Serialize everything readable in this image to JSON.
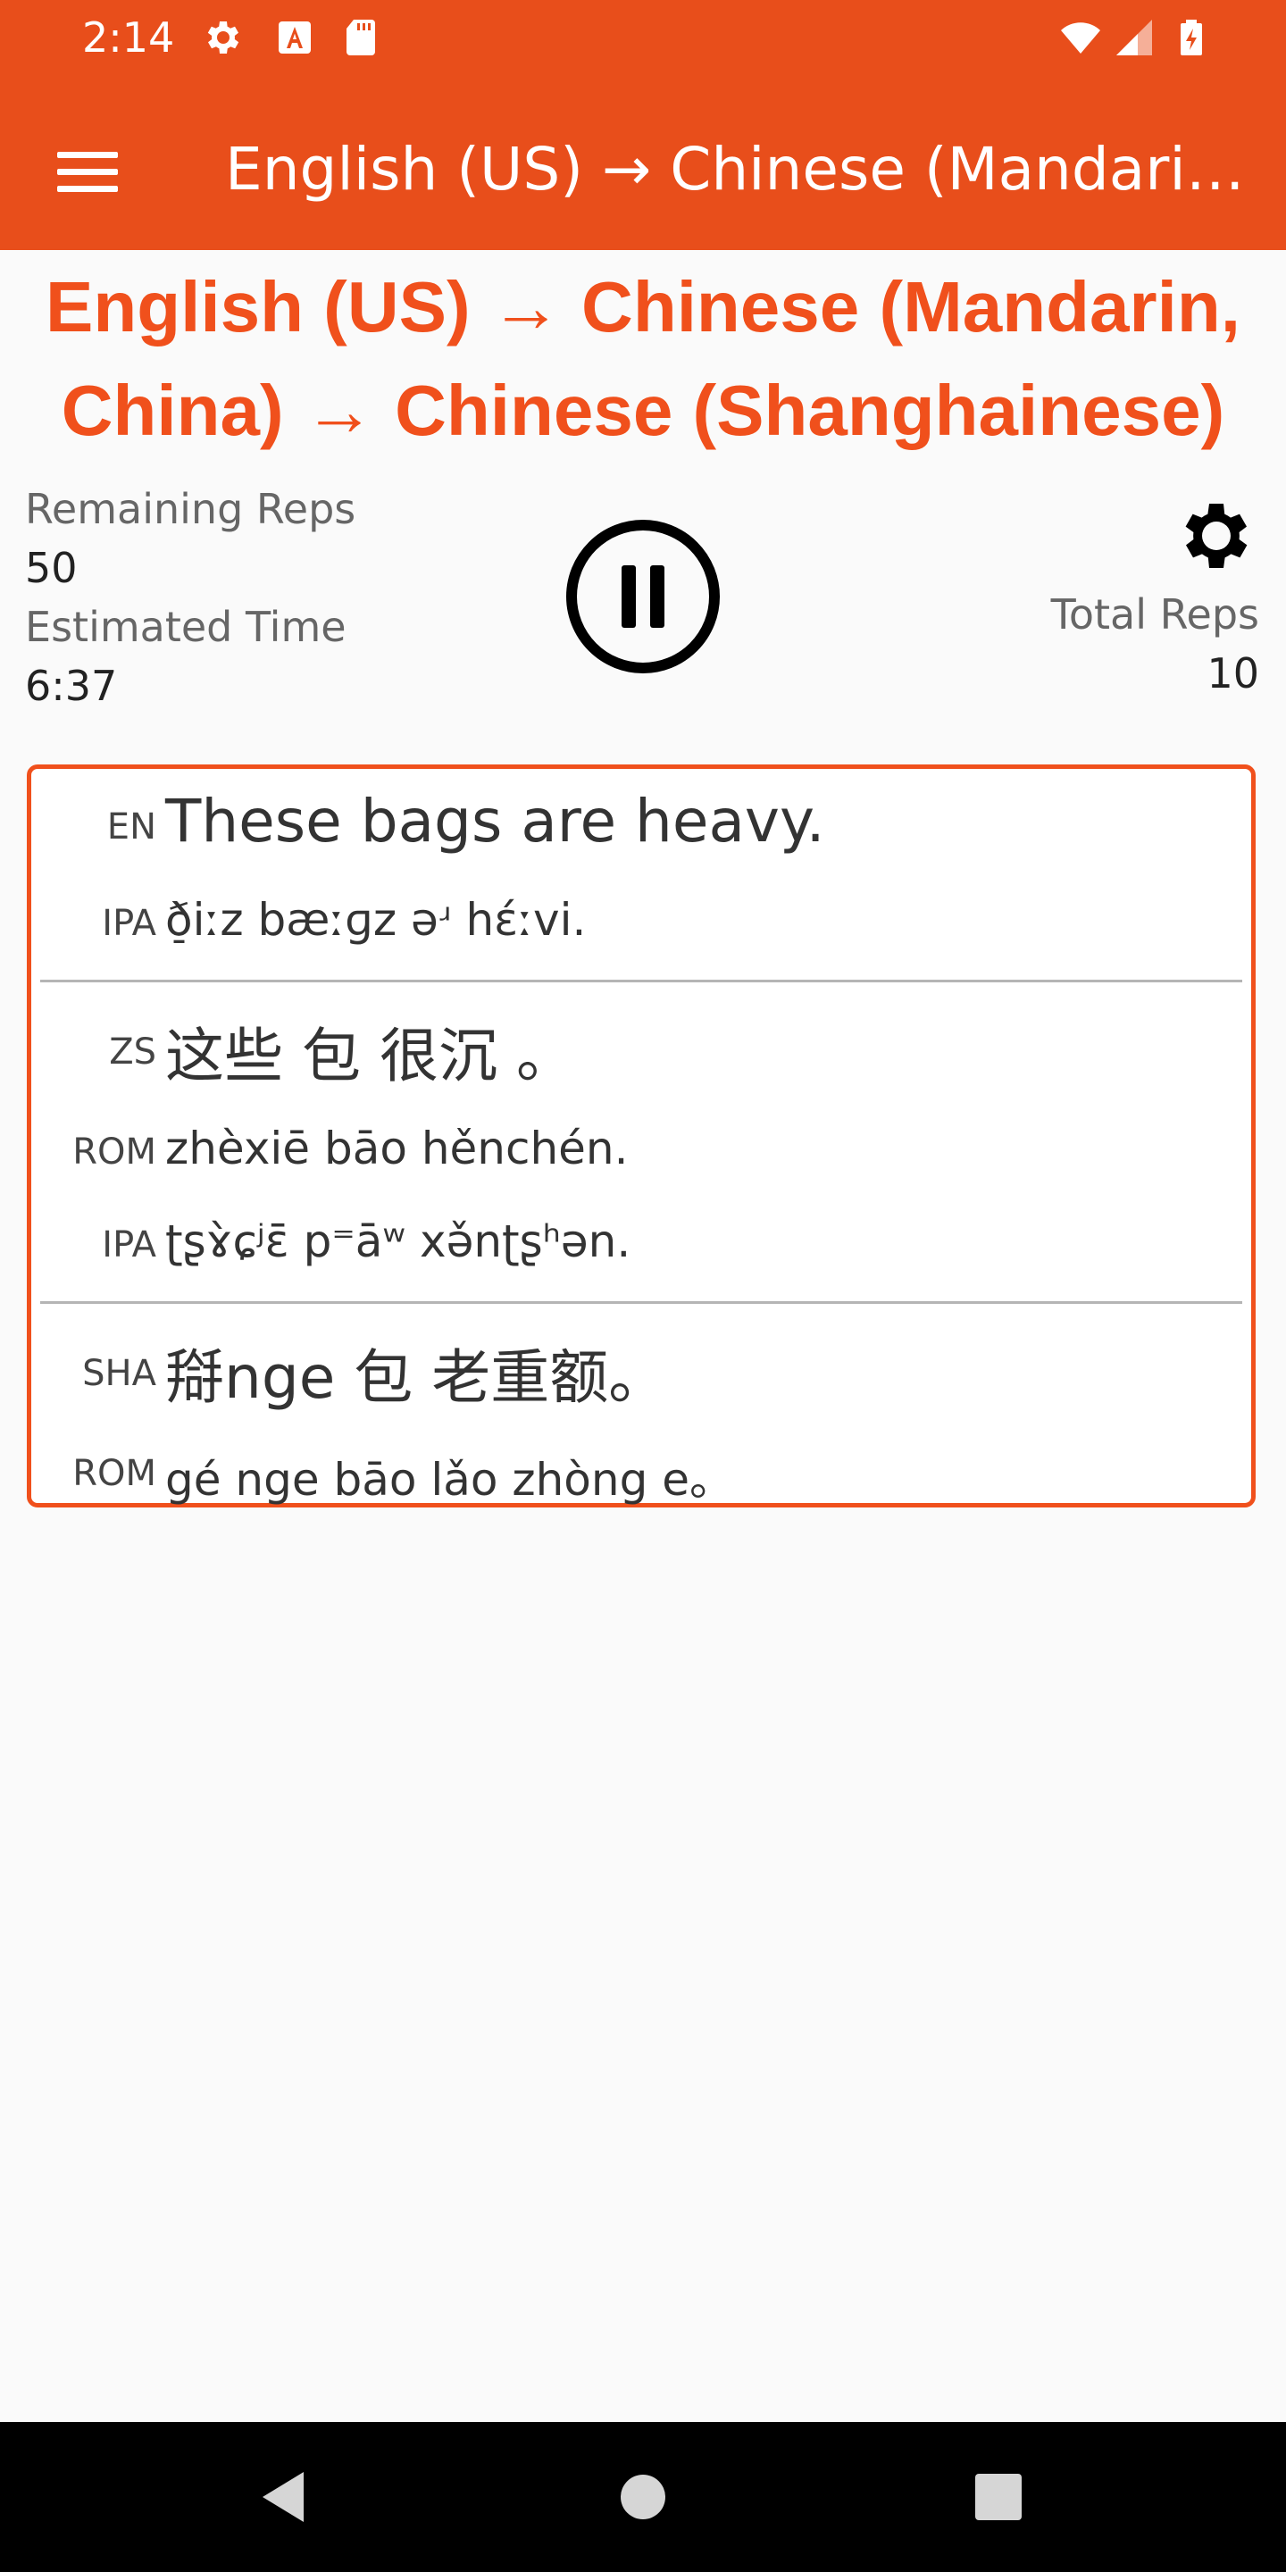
{
  "status_bar": {
    "time": "2:14",
    "icons": [
      "gear-icon",
      "font-a-icon",
      "sd-card-icon",
      "wifi-icon",
      "signal-icon",
      "battery-charging-icon"
    ]
  },
  "app_bar": {
    "title": "English (US) → Chinese (Mandarin,…",
    "menu_icon": "hamburger-menu-icon"
  },
  "heading": {
    "line1": "English (US) → Chinese (Mandarin,",
    "line2": "China) → Chinese (Shanghainese)"
  },
  "stats": {
    "remaining_reps_label": "Remaining Reps",
    "remaining_reps_value": "50",
    "estimated_time_label": "Estimated Time",
    "estimated_time_value": "6:37",
    "total_reps_label": "Total Reps",
    "total_reps_value": "10"
  },
  "controls": {
    "pause_icon": "pause-icon",
    "settings_icon": "gear-icon"
  },
  "card": {
    "english": {
      "tag": "EN",
      "text": "These bags are heavy.",
      "ipa_tag": "IPA",
      "ipa": "ð̠iːz bæːɡz əʴ hɛ́ːvi."
    },
    "mandarin": {
      "tag": "ZS",
      "text": "这些 包 很沉 。",
      "rom_tag": "ROM",
      "rom": "zhèxiē bāo hěnchén.",
      "ipa_tag": "IPA",
      "ipa": "ʈʂɤ̀ɕʲɛ̄ p⁼āʷ xə̌nʈʂʰən."
    },
    "shanghainese": {
      "tag": "SHA",
      "text": "搿nge 包 老重额。",
      "rom_tag": "ROM",
      "rom": "gé nge bāo lǎo zhòng e。"
    }
  },
  "colors": {
    "accent": "#e84e1b",
    "heading": "#f0501c",
    "background": "#fafafa"
  },
  "nav_bar": {
    "icons": [
      "back-icon",
      "home-icon",
      "recents-icon"
    ]
  }
}
